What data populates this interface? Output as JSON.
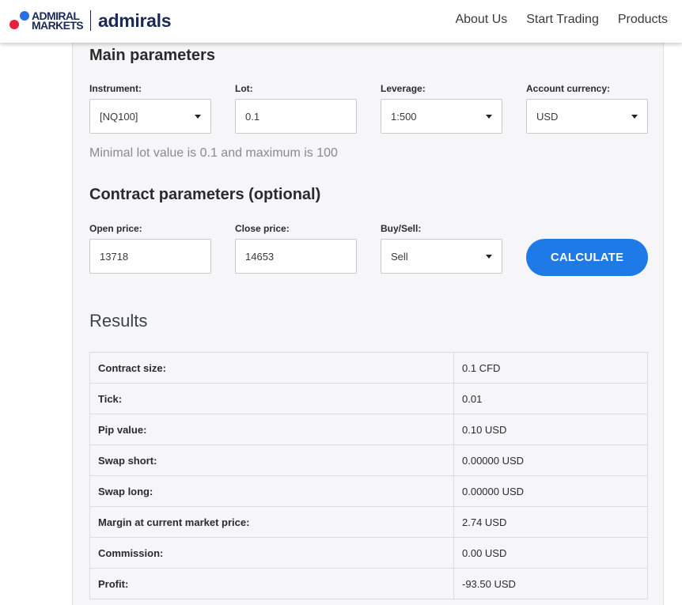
{
  "header": {
    "logo_line1": "ADMIRAL",
    "logo_line2": "MARKETS",
    "logo_brand": "admirals",
    "nav": [
      "About Us",
      "Start Trading",
      "Products"
    ]
  },
  "main_params": {
    "title": "Main parameters",
    "instrument": {
      "label": "Instrument:",
      "value": "[NQ100]"
    },
    "lot": {
      "label": "Lot:",
      "value": "0.1"
    },
    "leverage": {
      "label": "Leverage:",
      "value": "1:500"
    },
    "currency": {
      "label": "Account currency:",
      "value": "USD"
    },
    "hint": "Minimal lot value is 0.1 and maximum is 100"
  },
  "contract_params": {
    "title": "Contract parameters (optional)",
    "open_price": {
      "label": "Open price:",
      "value": "13718"
    },
    "close_price": {
      "label": "Close price:",
      "value": "14653"
    },
    "buy_sell": {
      "label": "Buy/Sell:",
      "value": "Sell"
    },
    "calculate_label": "CALCULATE"
  },
  "results": {
    "title": "Results",
    "rows": [
      {
        "key": "Contract size:",
        "value": "0.1 CFD"
      },
      {
        "key": "Tick:",
        "value": "0.01"
      },
      {
        "key": "Pip value:",
        "value": "0.10 USD"
      },
      {
        "key": "Swap short:",
        "value": "0.00000 USD"
      },
      {
        "key": "Swap long:",
        "value": "0.00000 USD"
      },
      {
        "key": "Margin at current market price:",
        "value": "2.74 USD"
      },
      {
        "key": "Commission:",
        "value": "0.00 USD"
      },
      {
        "key": "Profit:",
        "value": "-93.50 USD"
      }
    ]
  },
  "colors": {
    "accent": "#1e7ae6",
    "logo_blue": "#2a6ee6",
    "logo_red": "#e8203a",
    "brand_navy": "#1a2a55"
  }
}
